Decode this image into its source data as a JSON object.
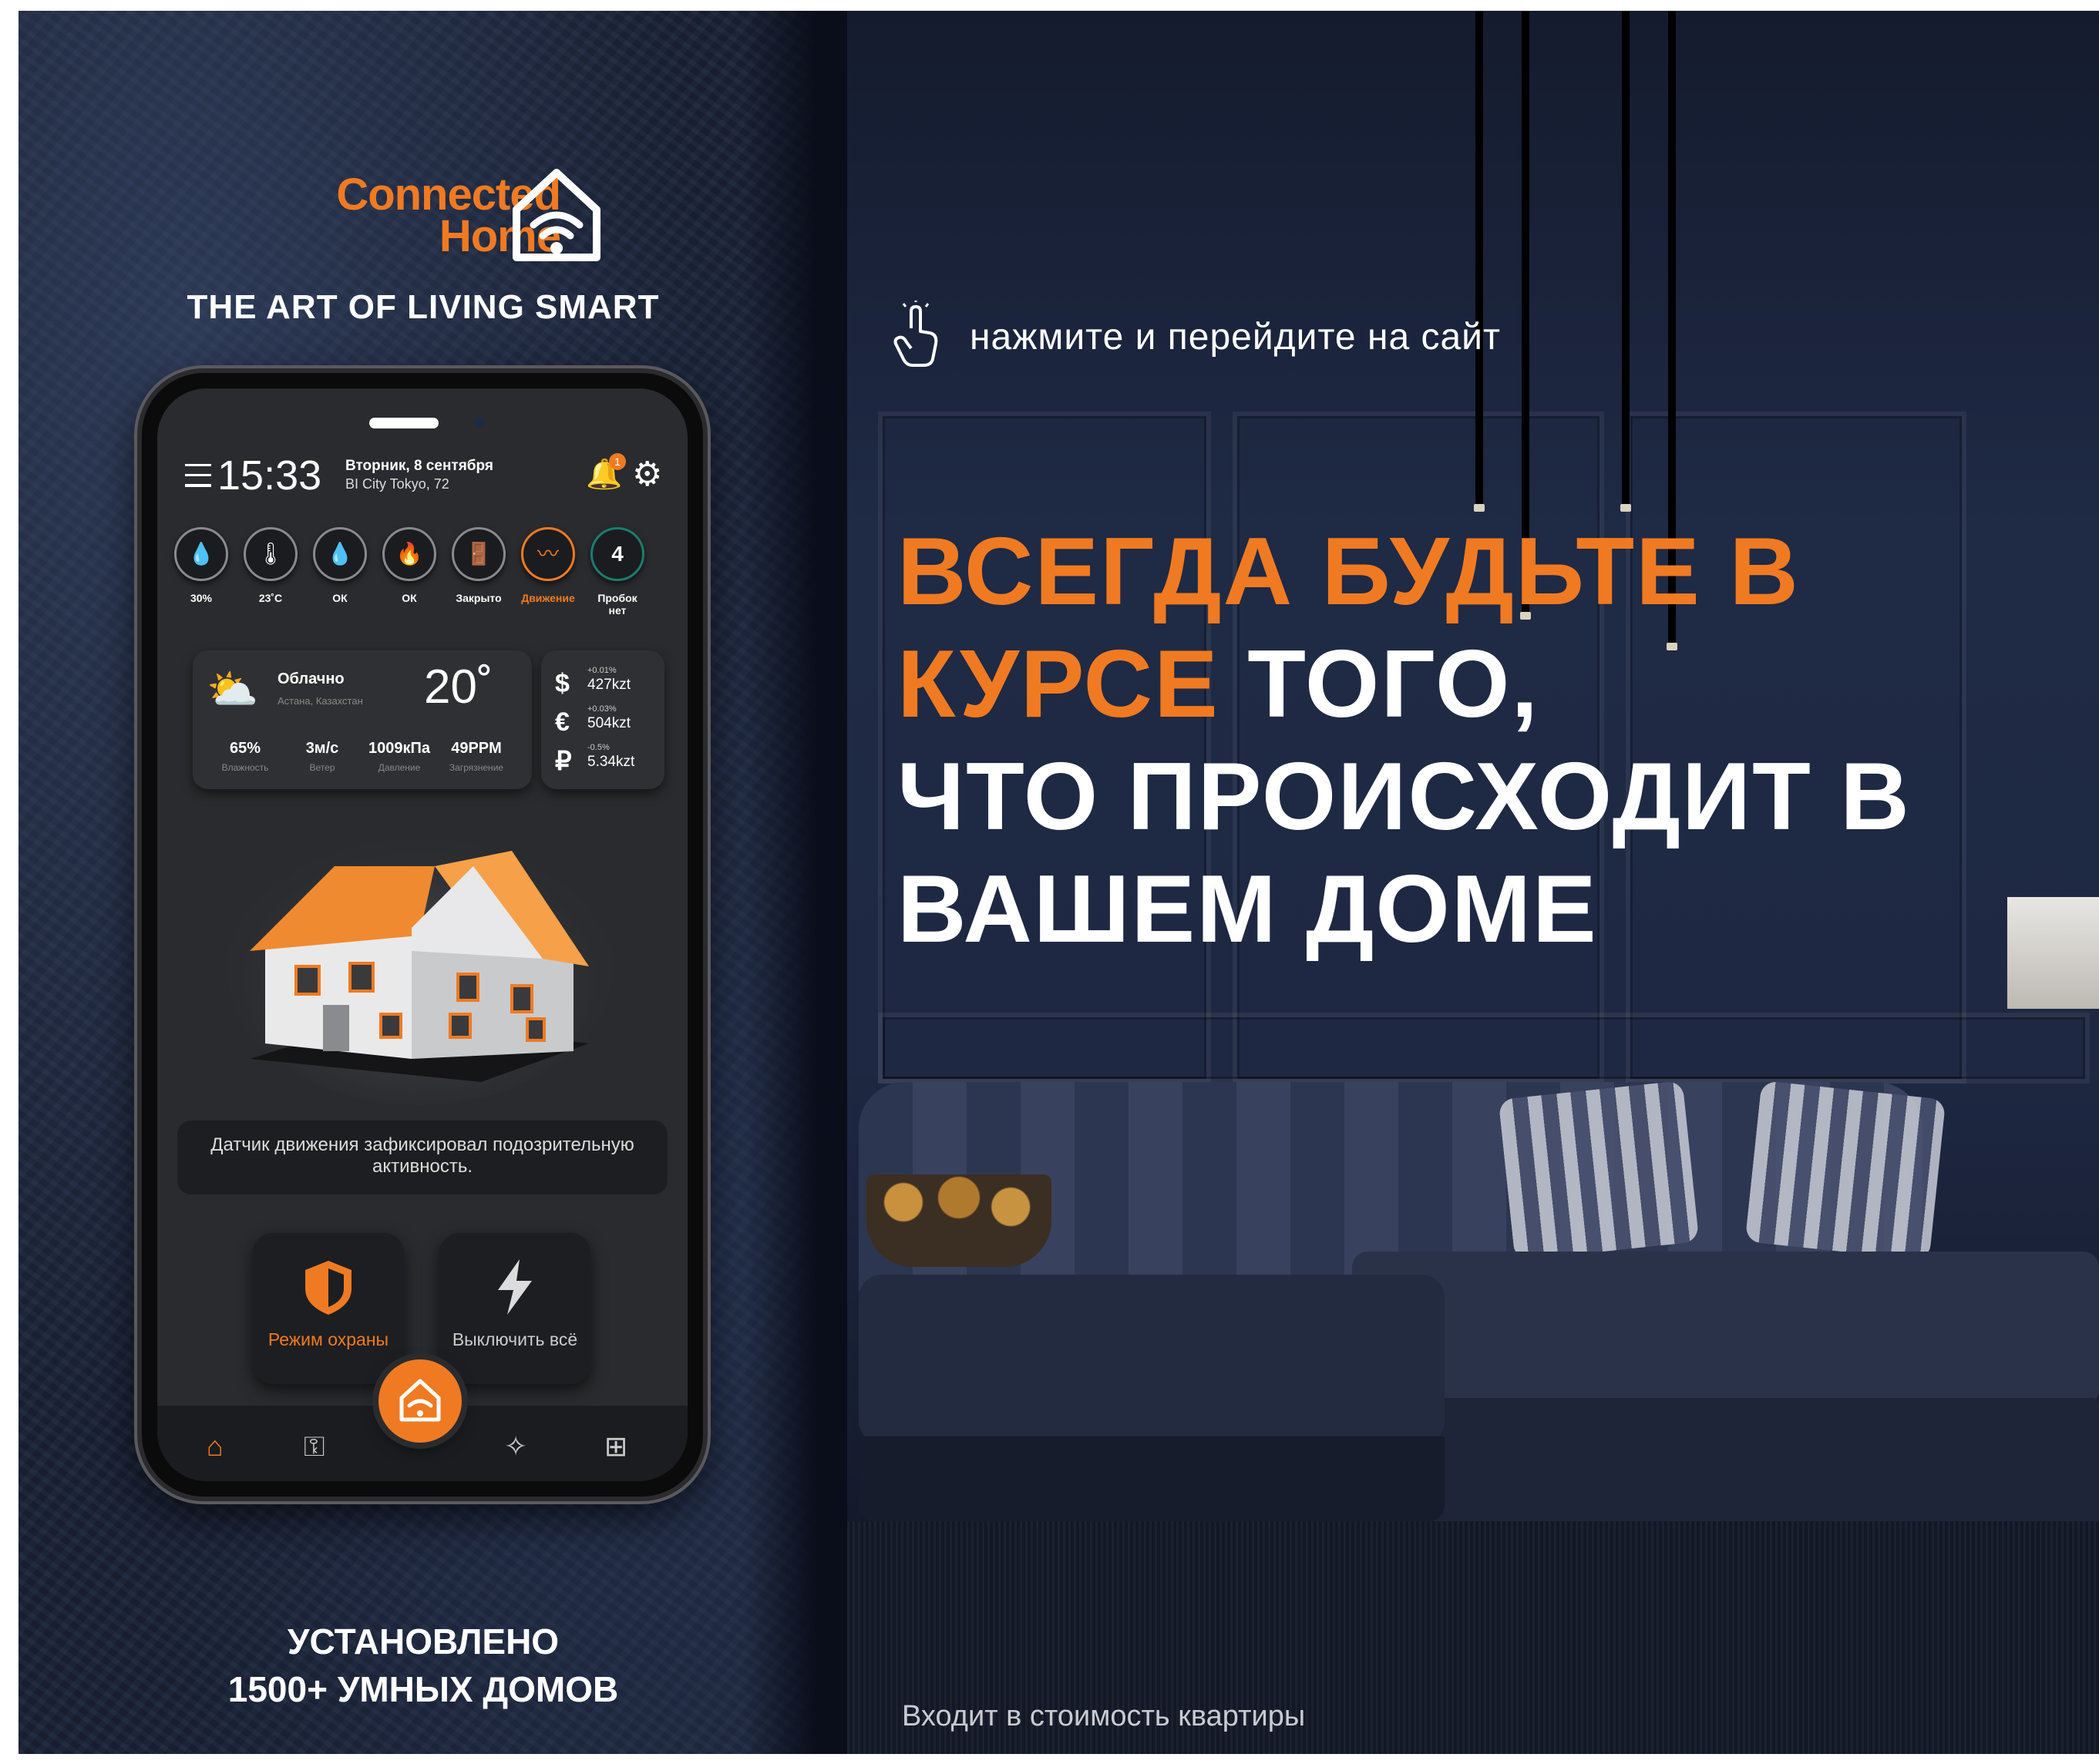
{
  "brand": {
    "logo_line1": "Connected",
    "logo_line2": "Home",
    "tagline": "THE ART OF LIVING SMART",
    "accent_color": "#f07a22"
  },
  "cta": {
    "icon": "tap-hand-icon",
    "text": "нажмите и перейдите на сайт"
  },
  "headline": {
    "orange_part": "ВСЕГДА БУДЬТЕ В КУРСЕ",
    "white_part1": "ТОГО,",
    "white_part2": "ЧТО ПРОИСХОДИТ В ВАШЕМ ДОМЕ"
  },
  "installed": {
    "line1": "УСТАНОВЛЕНО",
    "line2": "1500+ УМНЫХ ДОМОВ"
  },
  "footnote": "Входит в стоимость квартиры",
  "app": {
    "time": "15:33",
    "date": "Вторник, 8 сентября",
    "address": "BI City Tokyo, 72",
    "notification_count": "1",
    "sensors": [
      {
        "icon": "humidity-icon",
        "glyph": "💧",
        "label": "30%"
      },
      {
        "icon": "thermometer-icon",
        "glyph": "🌡",
        "label": "23˚C"
      },
      {
        "icon": "water-leak-icon",
        "glyph": "💧",
        "label": "ОК"
      },
      {
        "icon": "fire-icon",
        "glyph": "🔥",
        "label": "ОК"
      },
      {
        "icon": "door-icon",
        "glyph": "🚪",
        "label": "Закрыто"
      },
      {
        "icon": "motion-icon",
        "glyph": "〰",
        "label": "Движение"
      },
      {
        "icon": "traffic-icon",
        "glyph": "4",
        "label": "Пробок нет"
      }
    ],
    "weather": {
      "condition": "Облачно",
      "location": "Астана, Казахстан",
      "temperature": "20˚",
      "stats": [
        {
          "value": "65%",
          "label": "Влажность"
        },
        {
          "value": "3м/с",
          "label": "Ветер"
        },
        {
          "value": "1009кПа",
          "label": "Давление"
        },
        {
          "value": "49PPM",
          "label": "Загрязнение"
        }
      ]
    },
    "currency": [
      {
        "symbol": "$",
        "change": "+0.01%",
        "value": "427kzt"
      },
      {
        "symbol": "€",
        "change": "+0.03%",
        "value": "504kzt"
      },
      {
        "symbol": "₽",
        "change": "-0.5%",
        "value": "5.34kzt"
      }
    ],
    "alert": "Датчик движения зафиксировал подозрительную активность.",
    "actions": [
      {
        "icon": "shield-icon",
        "label": "Режим охраны"
      },
      {
        "icon": "lightning-icon",
        "label": "Выключить всё"
      }
    ]
  }
}
